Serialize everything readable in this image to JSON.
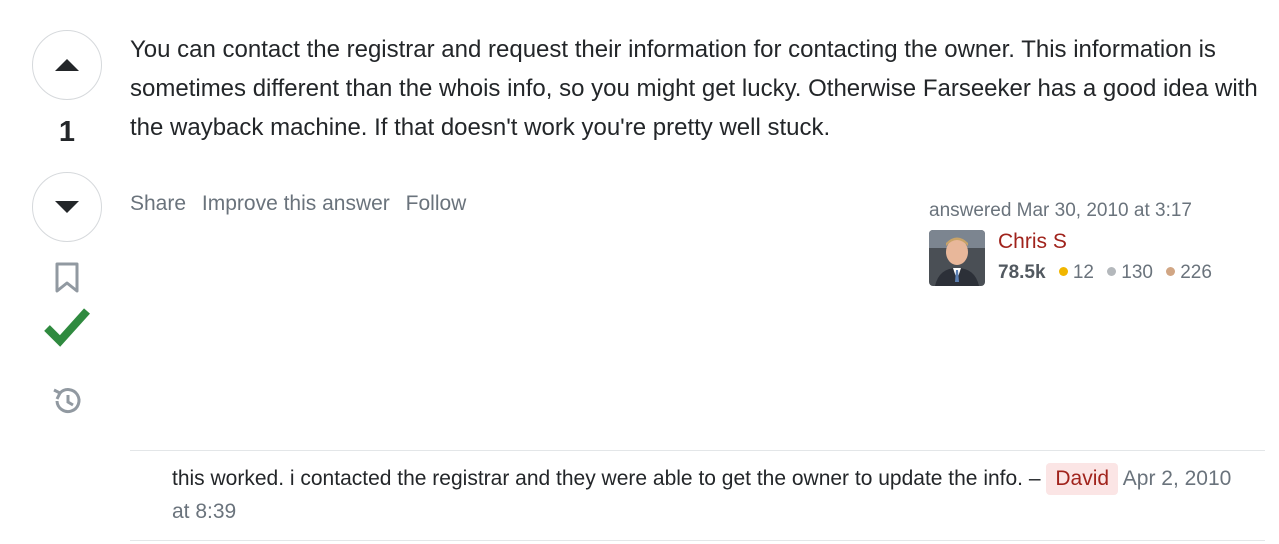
{
  "vote": {
    "count": "1",
    "up_icon": "arrow-up-icon",
    "down_icon": "arrow-down-icon",
    "bookmark_icon": "bookmark-icon",
    "accepted_icon": "checkmark-icon",
    "history_icon": "history-icon"
  },
  "answer": {
    "body": "You can contact the registrar and request their information for contacting the owner. This information is sometimes different than the whois info, so you might get lucky. Otherwise Farseeker has a good idea with the wayback machine. If that doesn't work you're pretty well stuck."
  },
  "menu": {
    "share": "Share",
    "improve": "Improve this answer",
    "follow": "Follow"
  },
  "user": {
    "action": "answered Mar 30, 2010 at 3:17",
    "name": "Chris S",
    "reputation": "78.5k",
    "gold": "12",
    "silver": "130",
    "bronze": "226"
  },
  "comment": {
    "text": "this worked. i contacted the registrar and they were able to get the owner to update the info. –",
    "user": "David",
    "date": "Apr 2, 2010 at 8:39"
  },
  "colors": {
    "accepted": "#2f8a3f",
    "link_user": "#a0231c",
    "muted": "#6a737c"
  }
}
